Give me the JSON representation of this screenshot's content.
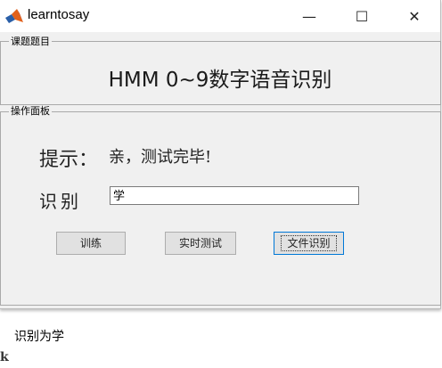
{
  "window": {
    "title": "learntosay",
    "controls": {
      "minimize": "—",
      "maximize": "☐",
      "close": "✕"
    }
  },
  "topic_panel": {
    "legend": "课题题目",
    "heading": "HMM 0~9数字语音识别"
  },
  "ops_panel": {
    "legend": "操作面板",
    "hint_label": "提示：",
    "hint_value": "亲，测试完毕!",
    "result_label": "识别",
    "result_value": "学",
    "buttons": {
      "train": "训练",
      "live_test": "实时测试",
      "file_recognize": "文件识别"
    }
  },
  "console": {
    "output": "识别为学",
    "edge_glyph": "k"
  },
  "colors": {
    "window_bg": "#f0f0f0",
    "titlebar_bg": "#ffffff",
    "button_bg": "#e1e1e1",
    "focus_border": "#0078d7"
  },
  "icons": {
    "app": "matlab-icon"
  }
}
